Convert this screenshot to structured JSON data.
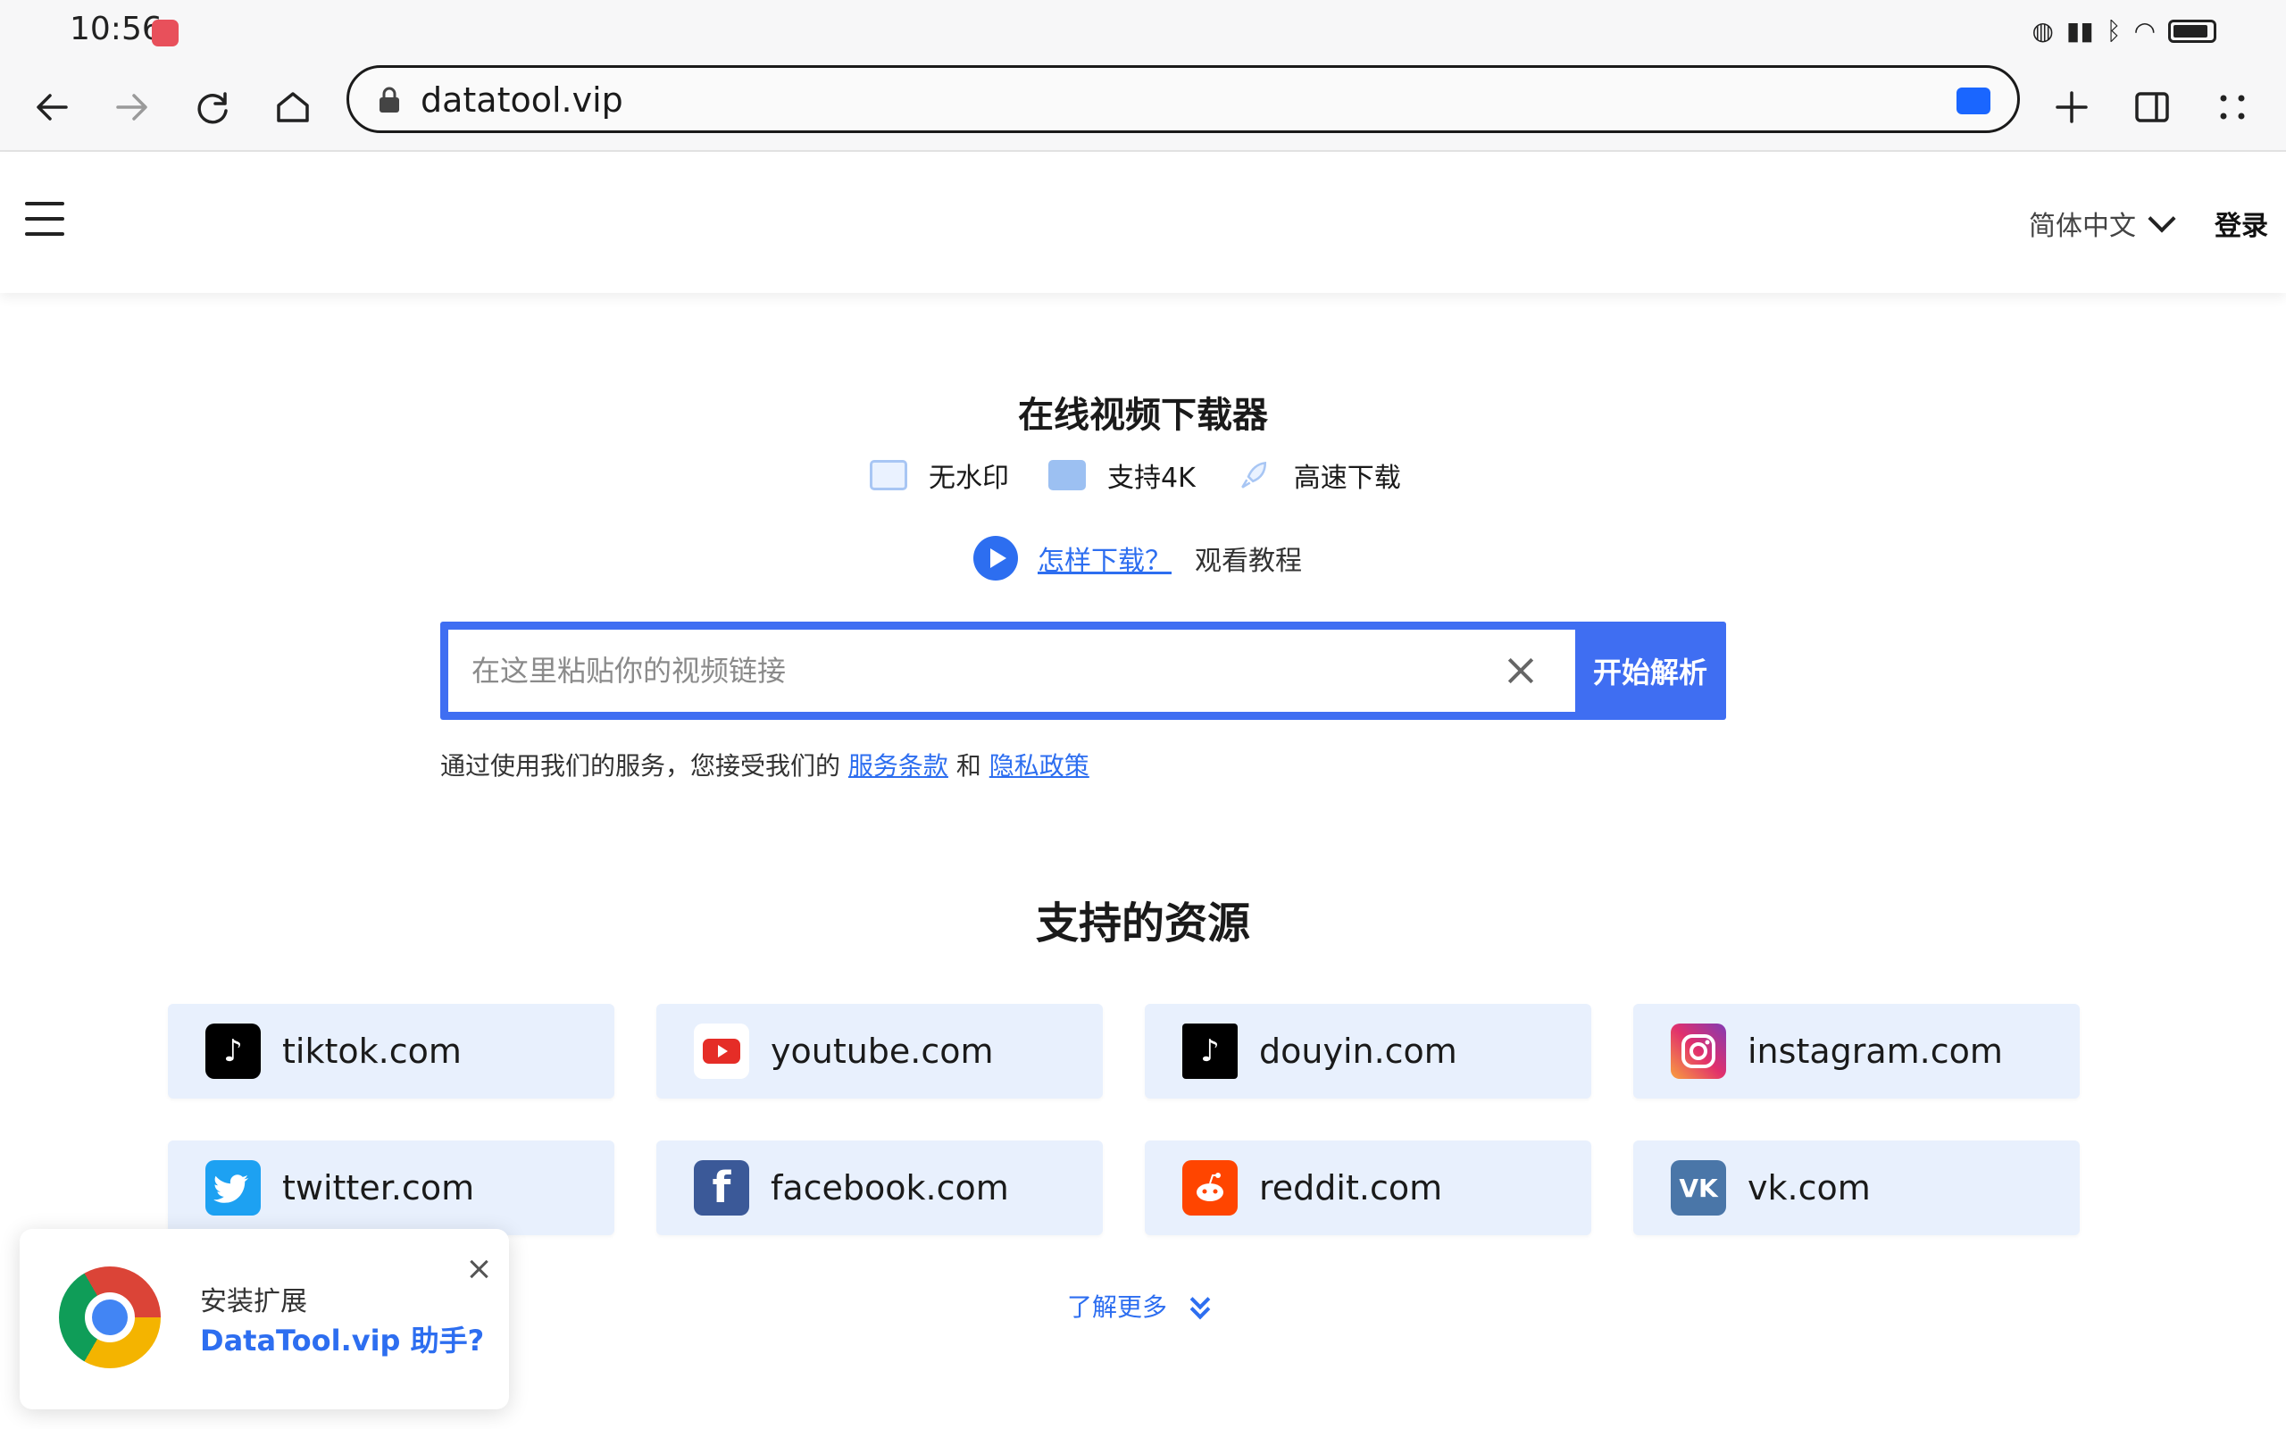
{
  "status": {
    "time": "10:56",
    "icons": [
      "nfc-icon",
      "reading-icon",
      "bluetooth-icon",
      "wifi-icon",
      "battery-icon"
    ]
  },
  "browser": {
    "url": "datatool.vip",
    "nav_icons": [
      "back-icon",
      "forward-icon",
      "reload-icon",
      "home-icon",
      "new-tab-icon",
      "sidebar-icon",
      "menu-icon"
    ]
  },
  "header": {
    "language": "简体中文",
    "login": "登录"
  },
  "hero": {
    "title": "在线视频下载器",
    "features": [
      "无水印",
      "支持4K",
      "高速下载"
    ],
    "howto_link": "怎样下载？",
    "howto_text": "观看教程",
    "search_placeholder": "在这里粘贴你的视频链接",
    "search_button": "开始解析",
    "terms_prefix": "通过使用我们的服务，您接受我们的",
    "terms_link": "服务条款",
    "terms_and": "和",
    "privacy_link": "隐私政策"
  },
  "sources": {
    "title": "支持的资源",
    "items": [
      {
        "label": "tiktok.com",
        "icon": "tiktok-icon",
        "color": "#000000"
      },
      {
        "label": "youtube.com",
        "icon": "youtube-icon",
        "color": "#ff0000"
      },
      {
        "label": "douyin.com",
        "icon": "douyin-icon",
        "color": "#000000"
      },
      {
        "label": "instagram.com",
        "icon": "instagram-icon",
        "color": "#e1306c"
      },
      {
        "label": "twitter.com",
        "icon": "twitter-icon",
        "color": "#1da1f2"
      },
      {
        "label": "facebook.com",
        "icon": "facebook-icon",
        "color": "#3b5998"
      },
      {
        "label": "reddit.com",
        "icon": "reddit-icon",
        "color": "#ff4500"
      },
      {
        "label": "vk.com",
        "icon": "vk-icon",
        "color": "#4a76a8"
      }
    ],
    "learn_more": "了解更多"
  },
  "popup": {
    "line1": "安装扩展",
    "line2": "DataTool.vip 助手?"
  },
  "colors": {
    "accent": "#2d6ef0",
    "search_border": "#3f6ef2",
    "card_bg": "#e8f0fd"
  }
}
